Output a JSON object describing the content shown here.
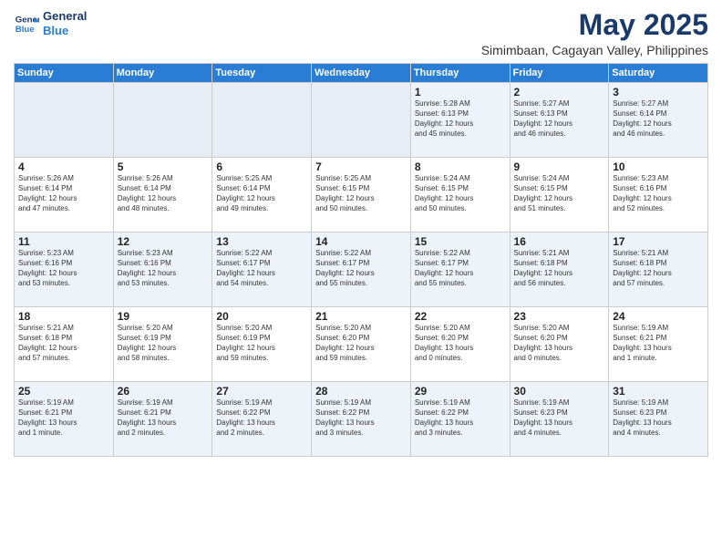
{
  "logo": {
    "line1": "General",
    "line2": "Blue"
  },
  "title": "May 2025",
  "subtitle": "Simimbaan, Cagayan Valley, Philippines",
  "weekdays": [
    "Sunday",
    "Monday",
    "Tuesday",
    "Wednesday",
    "Thursday",
    "Friday",
    "Saturday"
  ],
  "weeks": [
    [
      {
        "day": "",
        "info": ""
      },
      {
        "day": "",
        "info": ""
      },
      {
        "day": "",
        "info": ""
      },
      {
        "day": "",
        "info": ""
      },
      {
        "day": "1",
        "info": "Sunrise: 5:28 AM\nSunset: 6:13 PM\nDaylight: 12 hours\nand 45 minutes."
      },
      {
        "day": "2",
        "info": "Sunrise: 5:27 AM\nSunset: 6:13 PM\nDaylight: 12 hours\nand 46 minutes."
      },
      {
        "day": "3",
        "info": "Sunrise: 5:27 AM\nSunset: 6:14 PM\nDaylight: 12 hours\nand 46 minutes."
      }
    ],
    [
      {
        "day": "4",
        "info": "Sunrise: 5:26 AM\nSunset: 6:14 PM\nDaylight: 12 hours\nand 47 minutes."
      },
      {
        "day": "5",
        "info": "Sunrise: 5:26 AM\nSunset: 6:14 PM\nDaylight: 12 hours\nand 48 minutes."
      },
      {
        "day": "6",
        "info": "Sunrise: 5:25 AM\nSunset: 6:14 PM\nDaylight: 12 hours\nand 49 minutes."
      },
      {
        "day": "7",
        "info": "Sunrise: 5:25 AM\nSunset: 6:15 PM\nDaylight: 12 hours\nand 50 minutes."
      },
      {
        "day": "8",
        "info": "Sunrise: 5:24 AM\nSunset: 6:15 PM\nDaylight: 12 hours\nand 50 minutes."
      },
      {
        "day": "9",
        "info": "Sunrise: 5:24 AM\nSunset: 6:15 PM\nDaylight: 12 hours\nand 51 minutes."
      },
      {
        "day": "10",
        "info": "Sunrise: 5:23 AM\nSunset: 6:16 PM\nDaylight: 12 hours\nand 52 minutes."
      }
    ],
    [
      {
        "day": "11",
        "info": "Sunrise: 5:23 AM\nSunset: 6:16 PM\nDaylight: 12 hours\nand 53 minutes."
      },
      {
        "day": "12",
        "info": "Sunrise: 5:23 AM\nSunset: 6:16 PM\nDaylight: 12 hours\nand 53 minutes."
      },
      {
        "day": "13",
        "info": "Sunrise: 5:22 AM\nSunset: 6:17 PM\nDaylight: 12 hours\nand 54 minutes."
      },
      {
        "day": "14",
        "info": "Sunrise: 5:22 AM\nSunset: 6:17 PM\nDaylight: 12 hours\nand 55 minutes."
      },
      {
        "day": "15",
        "info": "Sunrise: 5:22 AM\nSunset: 6:17 PM\nDaylight: 12 hours\nand 55 minutes."
      },
      {
        "day": "16",
        "info": "Sunrise: 5:21 AM\nSunset: 6:18 PM\nDaylight: 12 hours\nand 56 minutes."
      },
      {
        "day": "17",
        "info": "Sunrise: 5:21 AM\nSunset: 6:18 PM\nDaylight: 12 hours\nand 57 minutes."
      }
    ],
    [
      {
        "day": "18",
        "info": "Sunrise: 5:21 AM\nSunset: 6:18 PM\nDaylight: 12 hours\nand 57 minutes."
      },
      {
        "day": "19",
        "info": "Sunrise: 5:20 AM\nSunset: 6:19 PM\nDaylight: 12 hours\nand 58 minutes."
      },
      {
        "day": "20",
        "info": "Sunrise: 5:20 AM\nSunset: 6:19 PM\nDaylight: 12 hours\nand 59 minutes."
      },
      {
        "day": "21",
        "info": "Sunrise: 5:20 AM\nSunset: 6:20 PM\nDaylight: 12 hours\nand 59 minutes."
      },
      {
        "day": "22",
        "info": "Sunrise: 5:20 AM\nSunset: 6:20 PM\nDaylight: 13 hours\nand 0 minutes."
      },
      {
        "day": "23",
        "info": "Sunrise: 5:20 AM\nSunset: 6:20 PM\nDaylight: 13 hours\nand 0 minutes."
      },
      {
        "day": "24",
        "info": "Sunrise: 5:19 AM\nSunset: 6:21 PM\nDaylight: 13 hours\nand 1 minute."
      }
    ],
    [
      {
        "day": "25",
        "info": "Sunrise: 5:19 AM\nSunset: 6:21 PM\nDaylight: 13 hours\nand 1 minute."
      },
      {
        "day": "26",
        "info": "Sunrise: 5:19 AM\nSunset: 6:21 PM\nDaylight: 13 hours\nand 2 minutes."
      },
      {
        "day": "27",
        "info": "Sunrise: 5:19 AM\nSunset: 6:22 PM\nDaylight: 13 hours\nand 2 minutes."
      },
      {
        "day": "28",
        "info": "Sunrise: 5:19 AM\nSunset: 6:22 PM\nDaylight: 13 hours\nand 3 minutes."
      },
      {
        "day": "29",
        "info": "Sunrise: 5:19 AM\nSunset: 6:22 PM\nDaylight: 13 hours\nand 3 minutes."
      },
      {
        "day": "30",
        "info": "Sunrise: 5:19 AM\nSunset: 6:23 PM\nDaylight: 13 hours\nand 4 minutes."
      },
      {
        "day": "31",
        "info": "Sunrise: 5:19 AM\nSunset: 6:23 PM\nDaylight: 13 hours\nand 4 minutes."
      }
    ]
  ]
}
